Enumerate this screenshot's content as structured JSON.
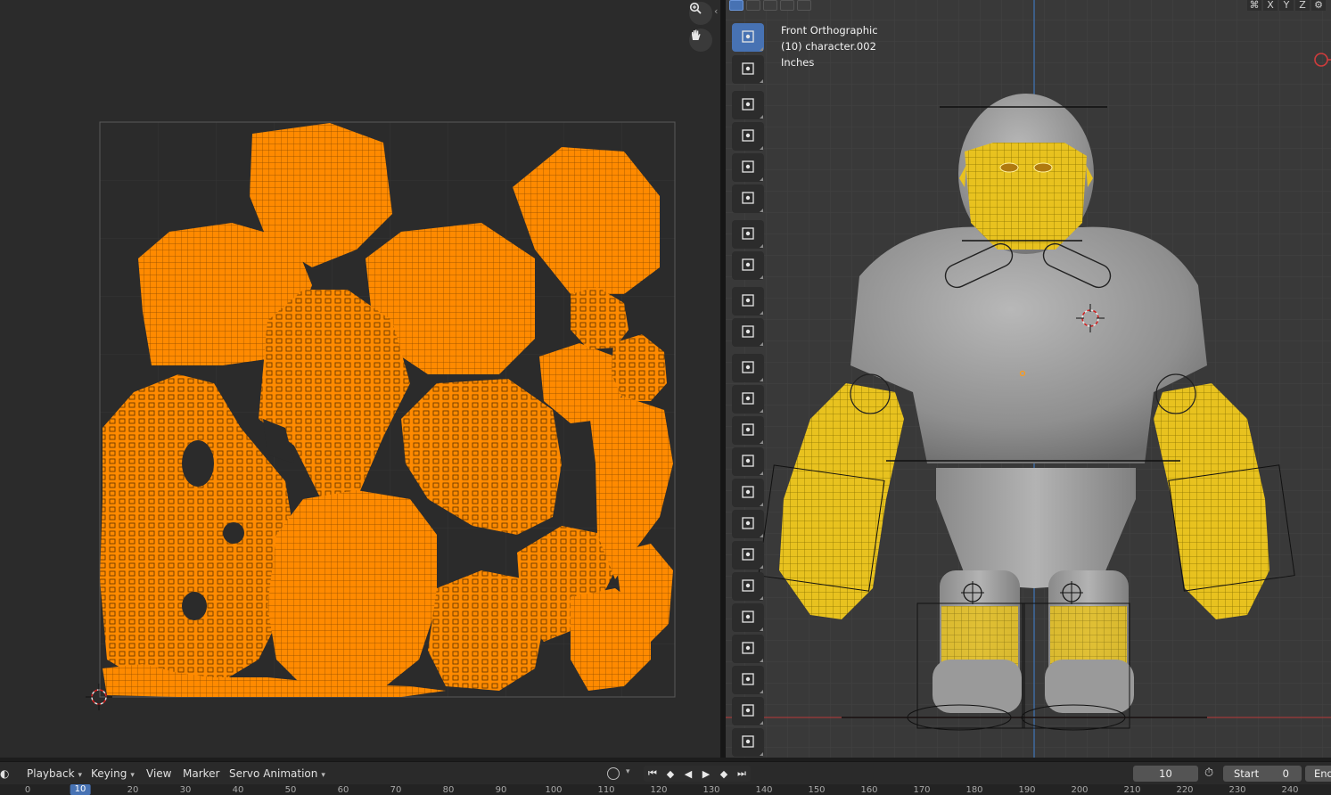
{
  "uv_editor": {
    "zoom_icon": "zoom-in-icon",
    "pan_icon": "hand-pan-icon",
    "collapse_icon": "chevron-left-icon"
  },
  "viewport": {
    "view_name": "Front Orthographic",
    "object_label": "(10) character.002",
    "units": "Inches",
    "axis_toggles": [
      "X",
      "Y",
      "Z"
    ]
  },
  "toolbar": {
    "tools": [
      {
        "name": "select-box-tool",
        "icon": "cursor-arrow-icon"
      },
      {
        "name": "cursor-tool",
        "icon": "crosshair-icon"
      },
      {
        "name": "move-tool",
        "icon": "move-arrows-icon"
      },
      {
        "name": "rotate-tool",
        "icon": "rotate-icon"
      },
      {
        "name": "scale-tool",
        "icon": "scale-icon"
      },
      {
        "name": "transform-tool",
        "icon": "transform-icon"
      },
      {
        "name": "annotate-tool",
        "icon": "pencil-icon"
      },
      {
        "name": "measure-tool",
        "icon": "ruler-icon"
      },
      {
        "name": "add-cube-tool",
        "icon": "add-cube-icon"
      },
      {
        "name": "cut-tool",
        "icon": "scissors-cube-icon"
      },
      {
        "name": "extrude-tool",
        "icon": "extrude-icon"
      },
      {
        "name": "inset-tool",
        "icon": "inset-icon"
      },
      {
        "name": "bevel-tool",
        "icon": "bevel-icon"
      },
      {
        "name": "loop-cut-tool",
        "icon": "loop-cut-icon"
      },
      {
        "name": "knife-tool",
        "icon": "knife-icon"
      },
      {
        "name": "poly-build-tool",
        "icon": "poly-build-icon"
      },
      {
        "name": "spin-tool",
        "icon": "spin-icon"
      },
      {
        "name": "smooth-tool",
        "icon": "smooth-icon"
      },
      {
        "name": "edge-slide-tool",
        "icon": "edge-slide-icon"
      },
      {
        "name": "shrink-fatten-tool",
        "icon": "shrink-fatten-icon"
      },
      {
        "name": "shear-tool",
        "icon": "shear-icon"
      },
      {
        "name": "rip-region-tool",
        "icon": "rip-region-icon"
      },
      {
        "name": "to-sphere-tool",
        "icon": "to-sphere-icon"
      }
    ]
  },
  "timeline": {
    "menus": {
      "playback": "Playback",
      "keying": "Keying",
      "view": "View",
      "marker": "Marker",
      "action": "Servo Animation"
    },
    "current_frame": "10",
    "start_label": "Start",
    "start_value": "0",
    "end_label": "End",
    "ruler_ticks": [
      "0",
      "10",
      "20",
      "30",
      "40",
      "50",
      "60",
      "70",
      "80",
      "90",
      "100",
      "110",
      "120",
      "130",
      "140",
      "150",
      "160",
      "170",
      "180",
      "190",
      "200",
      "210",
      "220",
      "230",
      "240"
    ]
  },
  "colors": {
    "uv_island": "#ff8a00",
    "wire_select": "#ffd21a",
    "active_tool": "#4772b3",
    "viewport_bg": "#393939",
    "uv_bg": "#2b2b2b"
  }
}
